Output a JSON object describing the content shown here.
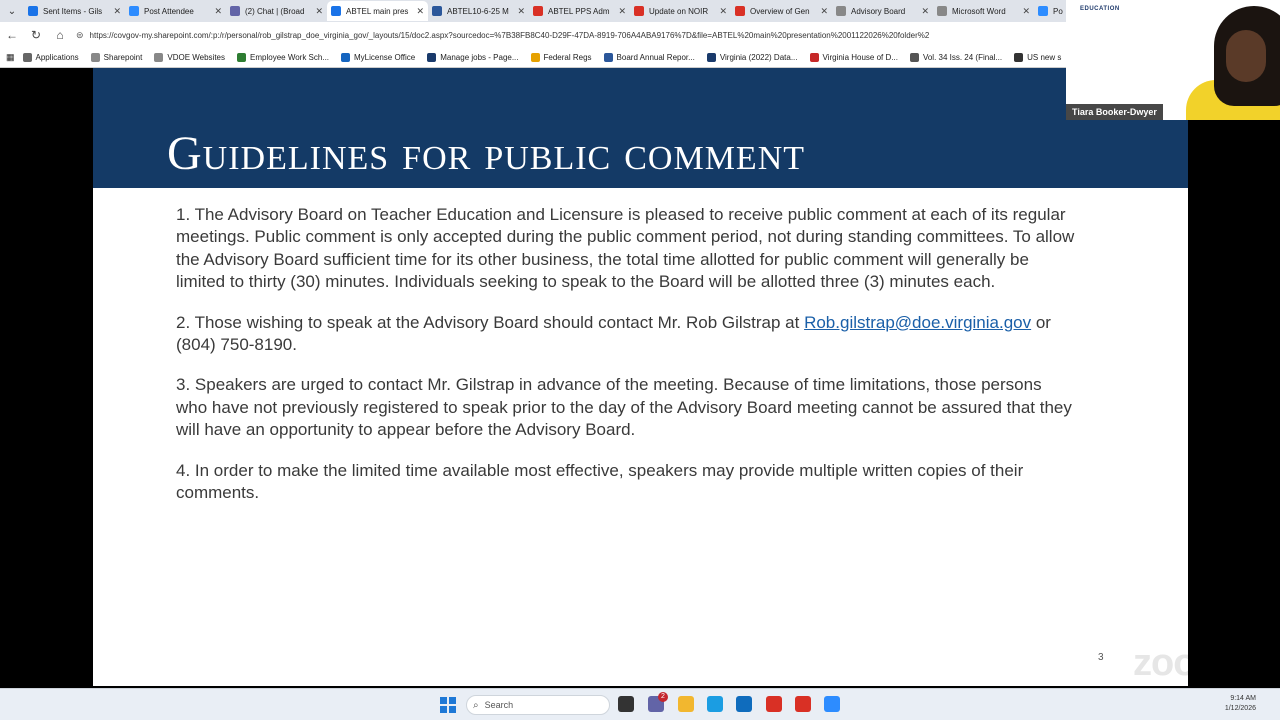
{
  "browser": {
    "tabs": [
      {
        "title": "Sent Items - Gils",
        "color": "#1a73e8"
      },
      {
        "title": "Post Attendee",
        "color": "#2d8cff"
      },
      {
        "title": "(2) Chat | (Broad",
        "color": "#6264a7"
      },
      {
        "title": "ABTEL main pres",
        "color": "#1a73e8",
        "active": true
      },
      {
        "title": "ABTEL10-6-25 M",
        "color": "#2b579a"
      },
      {
        "title": "ABTEL PPS Adm",
        "color": "#d93025"
      },
      {
        "title": "Update on NOIR",
        "color": "#d93025"
      },
      {
        "title": "Overview of Gen",
        "color": "#d93025"
      },
      {
        "title": "Advisory Board",
        "color": "#888888"
      },
      {
        "title": "Microsoft Word",
        "color": "#888888"
      },
      {
        "title": "Po",
        "color": "#2d8cff"
      }
    ],
    "url": "https://covgov-my.sharepoint.com/:p:/r/personal/rob_gilstrap_doe_virginia_gov/_layouts/15/doc2.aspx?sourcedoc=%7B38FB8C40-D29F-47DA-8919-706A4ABA9176%7D&file=ABTEL%20main%20presentation%2001122026%20folder%2",
    "bookmarks": [
      {
        "label": "Applications",
        "color": "#666666"
      },
      {
        "label": "Sharepoint",
        "color": "#888888"
      },
      {
        "label": "VDOE Websites",
        "color": "#888888"
      },
      {
        "label": "Employee Work Sch...",
        "color": "#2e7d32"
      },
      {
        "label": "MyLicense Office",
        "color": "#1565c0"
      },
      {
        "label": "Manage jobs - Page...",
        "color": "#1a3a6b"
      },
      {
        "label": "Federal Regs",
        "color": "#e6a100"
      },
      {
        "label": "Board Annual Repor...",
        "color": "#2b579a"
      },
      {
        "label": "Virginia (2022) Data...",
        "color": "#1a3a6b"
      },
      {
        "label": "Virginia House of D...",
        "color": "#c62828"
      },
      {
        "label": "Vol. 34 Iss. 24 (Final...",
        "color": "#555555"
      },
      {
        "label": "US new s",
        "color": "#333333"
      }
    ]
  },
  "video": {
    "participant_name": "Tiara Booker-Dwyer",
    "logo_text": "EDUCATION"
  },
  "slide": {
    "title": "Guidelines for public comment",
    "items": [
      {
        "text": "1.  The Advisory Board on Teacher Education and Licensure is pleased to receive public comment at each of its regular meetings. Public comment is only accepted during the public comment period, not during standing committees. To allow the Advisory Board sufficient time for its other business, the total time allotted for public comment will generally be limited to thirty (30) minutes. Individuals seeking to speak to the Board will be allotted three (3) minutes each."
      },
      {
        "text_before": "2.  Those wishing to speak at the Advisory Board should contact Mr. Rob Gilstrap at ",
        "link": "Rob.gilstrap@doe.virginia.gov",
        "text_after": " or (804) 750-8190."
      },
      {
        "text": "3.  Speakers are urged to contact Mr. Gilstrap in advance of the meeting. Because of time limitations, those persons who have not previously registered to speak prior to the day of the Advisory Board meeting cannot be assured that they will have an opportunity to appear before the Advisory Board."
      },
      {
        "text": "4.  In order to make the limited time available most effective, speakers may provide multiple written copies of their comments."
      }
    ],
    "slide_number": "3",
    "watermark": "zoom"
  },
  "taskbar": {
    "search_placeholder": "Search",
    "badge": "2",
    "time": "9:14 AM",
    "date": "1/12/2026",
    "icons": [
      {
        "name": "task-view-icon",
        "color": "#333333"
      },
      {
        "name": "teams-icon",
        "color": "#6264a7"
      },
      {
        "name": "file-explorer-icon",
        "color": "#f2b72f"
      },
      {
        "name": "edge-icon",
        "color": "#1b9de2"
      },
      {
        "name": "outlook-icon",
        "color": "#0f6cbd"
      },
      {
        "name": "app-icon",
        "color": "#d93025"
      },
      {
        "name": "acrobat-icon",
        "color": "#d93025"
      },
      {
        "name": "zoom-icon",
        "color": "#2d8cff"
      }
    ]
  }
}
